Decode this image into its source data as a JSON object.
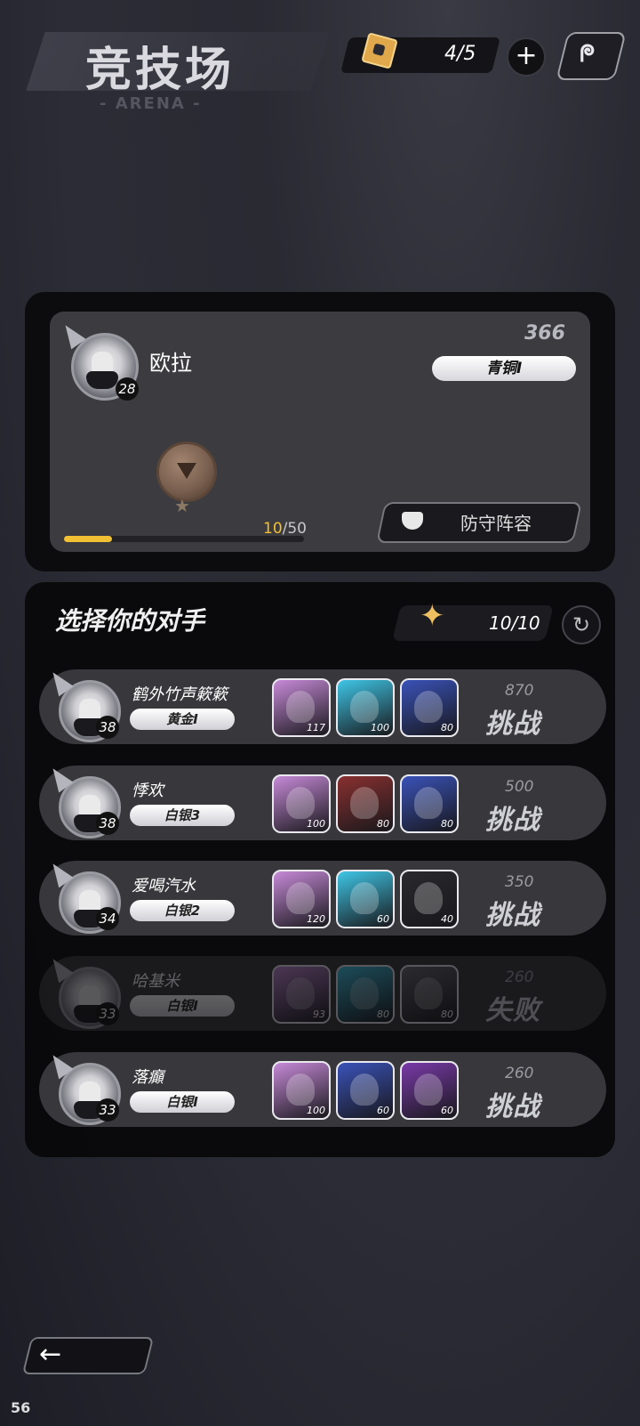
{
  "header": {
    "title": "竞技场",
    "subtitle": "- ARENA -",
    "energy": "4/5",
    "plus_label": "+",
    "ref_icon": "ᖘ"
  },
  "player": {
    "name": "欧拉",
    "level": "28",
    "score": "366",
    "rank": "青铜I",
    "exp_current": "10",
    "exp_total": "/50",
    "exp_fraction": 0.2,
    "defense_label": "防守阵容"
  },
  "opponents_panel": {
    "title": "选择你的对手",
    "tickets": "10/10",
    "refresh_icon": "↻"
  },
  "opponents": [
    {
      "name": "鹤外竹声簌簌",
      "level": "38",
      "rank": "黄金I",
      "power": "870",
      "action": "挑战",
      "defeated": false,
      "heroes": [
        {
          "lv": "117",
          "color": "#c78ad8"
        },
        {
          "lv": "100",
          "color": "#3fc6e6"
        },
        {
          "lv": "80",
          "color": "#3a52b8"
        }
      ]
    },
    {
      "name": "悸欢",
      "level": "38",
      "rank": "白银3",
      "power": "500",
      "action": "挑战",
      "defeated": false,
      "heroes": [
        {
          "lv": "100",
          "color": "#c78ad8"
        },
        {
          "lv": "80",
          "color": "#8a3030"
        },
        {
          "lv": "80",
          "color": "#3a52b8"
        }
      ]
    },
    {
      "name": "爱喝汽水",
      "level": "34",
      "rank": "白银2",
      "power": "350",
      "action": "挑战",
      "defeated": false,
      "heroes": [
        {
          "lv": "120",
          "color": "#c78ad8"
        },
        {
          "lv": "60",
          "color": "#3fc6e6"
        },
        {
          "lv": "40",
          "color": "#2a2a2e"
        }
      ]
    },
    {
      "name": "哈基米",
      "level": "33",
      "rank": "白银I",
      "power": "260",
      "action": "失败",
      "defeated": true,
      "heroes": [
        {
          "lv": "93",
          "color": "#c78ad8"
        },
        {
          "lv": "80",
          "color": "#3fc6e6"
        },
        {
          "lv": "80",
          "color": "#6a6a70"
        }
      ]
    },
    {
      "name": "落癲",
      "level": "33",
      "rank": "白银I",
      "power": "260",
      "action": "挑战",
      "defeated": false,
      "heroes": [
        {
          "lv": "100",
          "color": "#c78ad8"
        },
        {
          "lv": "60",
          "color": "#3a52b8"
        },
        {
          "lv": "60",
          "color": "#7a3aa8"
        }
      ]
    }
  ],
  "footer": {
    "back_icon": "←",
    "fps": "56"
  }
}
